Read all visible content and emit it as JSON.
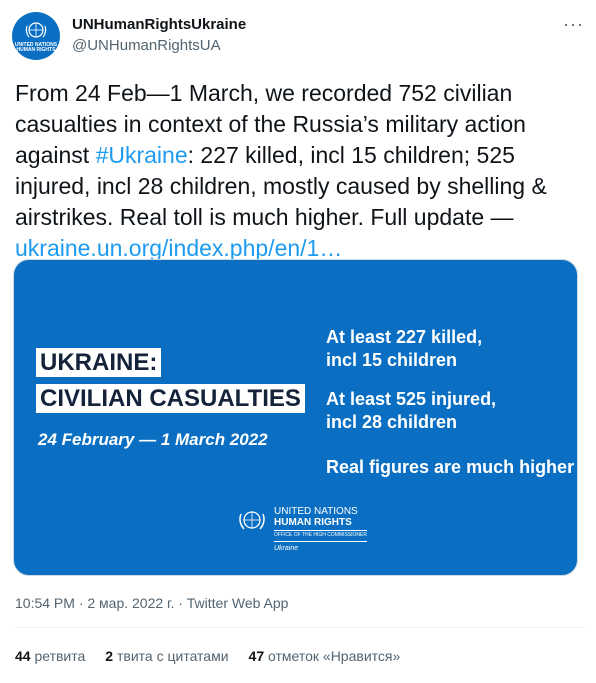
{
  "author": {
    "name": "UNHumanRightsUkraine",
    "handle": "@UNHumanRightsUA",
    "avatar_text": "UNITED NATIONS HUMAN RIGHTS"
  },
  "tweet": {
    "text_part1": "From 24 Feb—1 March, we recorded 752 civilian casualties in context of the Russia’s military action against ",
    "hashtag": "#Ukraine",
    "text_part2": ": 227 killed, incl 15 children; 525 injured, incl 28 children, mostly caused by shelling & airstrikes. Real toll is much higher. Full update —",
    "link": "ukraine.un.org/index.php/en/1…"
  },
  "media": {
    "headline_1": "UKRAINE:",
    "headline_2": "CIVILIAN CASUALTIES",
    "date_range": "24 February — 1 March 2022",
    "stat_killed_1": "At least 227 killed,",
    "stat_killed_2": "incl 15 children",
    "stat_injured_1": "At least 525 injured,",
    "stat_injured_2": "incl 28 children",
    "stat_real": "Real figures are much higher",
    "logo_line1": "UNITED NATIONS",
    "logo_line2": "HUMAN RIGHTS",
    "logo_line3": "OFFICE OF THE HIGH COMMISSIONER",
    "logo_line4": "Ukraine"
  },
  "meta": {
    "line": "10:54 PM · 2 мар. 2022 г. · Twitter Web App"
  },
  "stats": {
    "retweets_count": "44",
    "retweets_label": "ретвита",
    "quotes_count": "2",
    "quotes_label": "твита с цитатами",
    "likes_count": "47",
    "likes_label": "отметок «Нравится»"
  },
  "colors": {
    "accent": "#1d9bf0",
    "media_bg": "#0a6fc2"
  },
  "icons": {
    "avatar": "un-emblem-icon",
    "more": "more-dots-icon",
    "logo": "un-emblem-icon"
  }
}
